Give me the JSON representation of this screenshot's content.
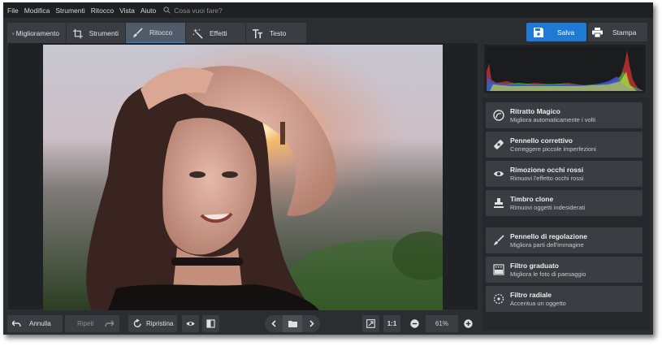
{
  "menu": [
    "File",
    "Modifica",
    "Strumenti",
    "Ritocco",
    "Vista",
    "Aiuto"
  ],
  "search": {
    "placeholder": "Cosa vuoi fare?"
  },
  "tabs": [
    {
      "label": "Miglioramento",
      "icon": "sliders-icon"
    },
    {
      "label": "Strumenti",
      "icon": "crop-icon"
    },
    {
      "label": "Ritocco",
      "icon": "brush-icon",
      "active": true
    },
    {
      "label": "Effetti",
      "icon": "magic-wand-icon"
    },
    {
      "label": "Testo",
      "icon": "text-icon"
    }
  ],
  "actions": {
    "save": "Salva",
    "print": "Stampa"
  },
  "tools": [
    {
      "title": "Ritratto Magico",
      "desc": "Migliora automaticamente i volti",
      "icon": "magic-portrait-icon"
    },
    {
      "title": "Pennello correttivo",
      "desc": "Correggere piccole imperfezioni",
      "icon": "healing-brush-icon"
    },
    {
      "title": "Rimozione occhi rossi",
      "desc": "Rimuovi l'effetto occhi rossi",
      "icon": "eye-icon"
    },
    {
      "title": "Timbro clone",
      "desc": "Rimuovi oggetti indesiderati",
      "icon": "clone-stamp-icon"
    },
    {
      "title": "Pennello di regolazione",
      "desc": "Migliora parti dell'immagine",
      "icon": "adjustment-brush-icon"
    },
    {
      "title": "Filtro graduato",
      "desc": "Migliora le foto di paesaggio",
      "icon": "graduated-filter-icon"
    },
    {
      "title": "Filtro radiale",
      "desc": "Accentua un oggetto",
      "icon": "radial-filter-icon"
    }
  ],
  "bottom": {
    "undo": "Annulla",
    "redo": "Ripeti",
    "reset": "Ripristina",
    "ratio": "1:1",
    "zoom": "61%"
  },
  "colors": {
    "accent": "#1f7ad6",
    "panel": "#2b2e31",
    "button": "#3a3e42"
  }
}
